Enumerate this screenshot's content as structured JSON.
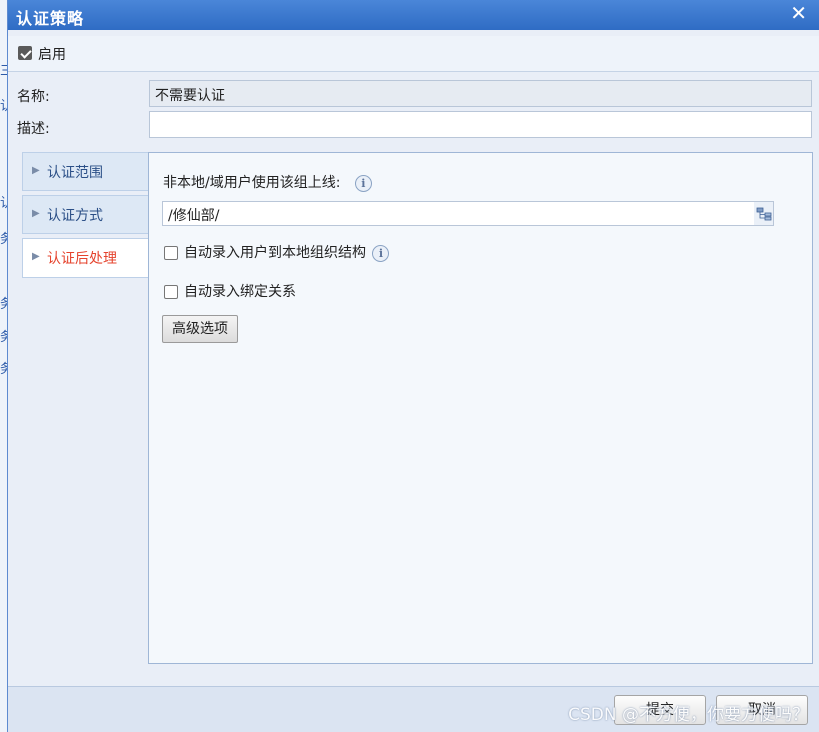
{
  "dialog": {
    "title": "认证策略",
    "close_glyph": "✕"
  },
  "enable": {
    "label": "启用",
    "checked": true
  },
  "fields": {
    "name_label": "名称:",
    "name_value": "不需要认证",
    "desc_label": "描述:",
    "desc_value": ""
  },
  "tabs": [
    {
      "label": "认证范围",
      "active": false
    },
    {
      "label": "认证方式",
      "active": false
    },
    {
      "label": "认证后处理",
      "active": true
    }
  ],
  "panel": {
    "group_label": "非本地/域用户使用该组上线:",
    "group_value": "/修仙部/",
    "auto_add_user_label": "自动录入用户到本地组织结构",
    "auto_add_user_checked": false,
    "auto_bind_label": "自动录入绑定关系",
    "auto_bind_checked": false,
    "advanced_button": "高级选项",
    "info_glyph": "i"
  },
  "footer": {
    "submit_label": "提交",
    "cancel_label": "取消"
  },
  "watermark": "CSDN @不方便，你要方便吗？",
  "background_page": {
    "fragments": [
      "三",
      "认",
      "认",
      "务",
      "务",
      "务",
      "务"
    ]
  },
  "colors": {
    "titlebar": "#3a78cc",
    "active_tab": "#e5432d",
    "tab_text": "#2b4f87"
  }
}
